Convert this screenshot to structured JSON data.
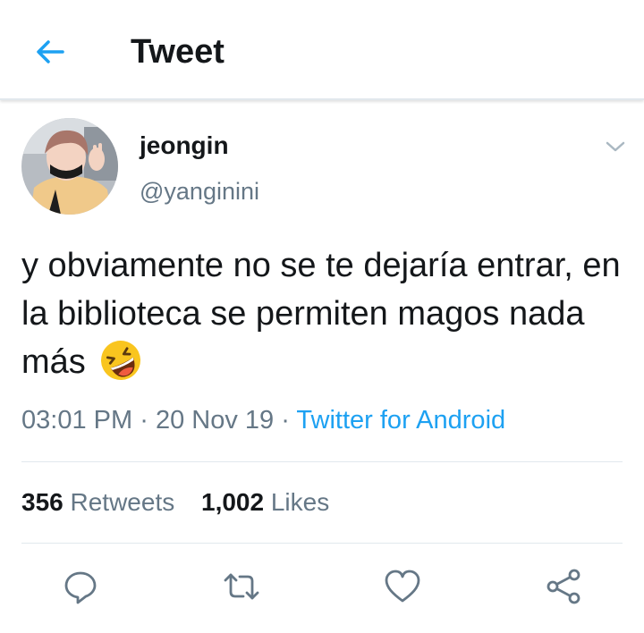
{
  "header": {
    "title": "Tweet",
    "back_icon": "arrow-left-icon"
  },
  "colors": {
    "accent": "#1da1f2",
    "text_primary": "#14171a",
    "text_secondary": "#657786",
    "divider": "#e1e8ed"
  },
  "tweet": {
    "author_name": "jeongin",
    "author_handle": "@yanginini",
    "text": "y obviamente no se te dejaría entrar, en la biblioteca se permiten magos nada más",
    "emoji": "rolling-on-floor-laughing-emoji",
    "time": "03:01 PM",
    "date": "20 Nov 19",
    "separator": "·",
    "source": "Twitter for Android"
  },
  "stats": {
    "retweets_count": "356",
    "retweets_label": "Retweets",
    "likes_count": "1,002",
    "likes_label": "Likes"
  },
  "actions": [
    {
      "name": "reply",
      "icon": "reply-icon"
    },
    {
      "name": "retweet",
      "icon": "retweet-icon"
    },
    {
      "name": "like",
      "icon": "heart-icon"
    },
    {
      "name": "share",
      "icon": "share-icon"
    }
  ]
}
